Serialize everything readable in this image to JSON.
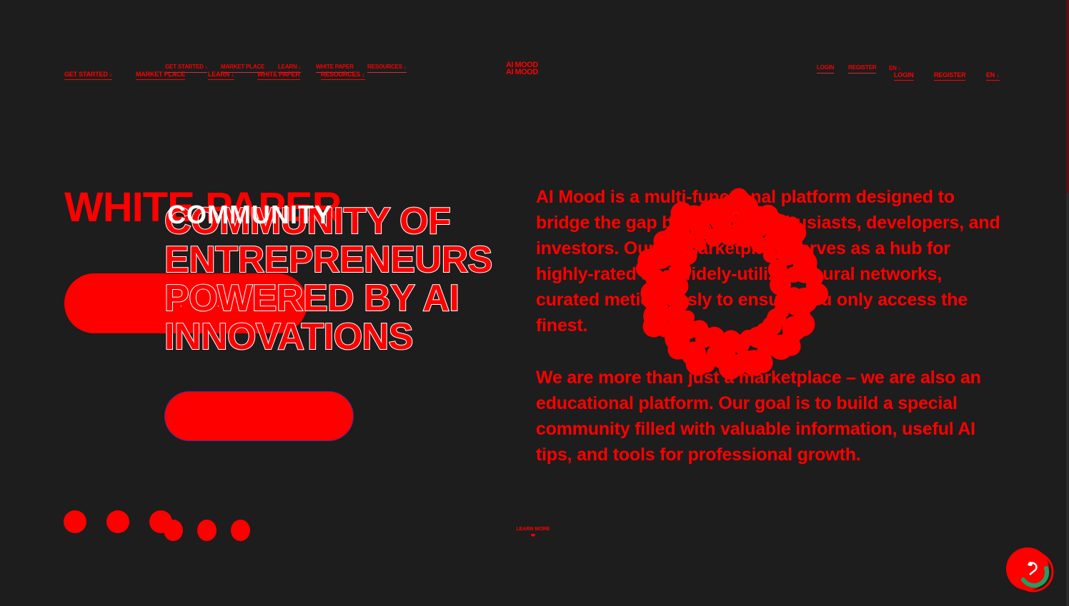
{
  "nav": {
    "left": [
      {
        "label": "GET STARTED ↓"
      },
      {
        "label": "MARKET PLACE"
      },
      {
        "label": "LEARN ↓"
      },
      {
        "label": "WHITE PAPER"
      },
      {
        "label": "RESOURCES ↓"
      }
    ],
    "left_ghost": [
      {
        "label": "GET STARTED ↓"
      },
      {
        "label": "MARKET PLACE"
      },
      {
        "label": "LEARN ↓"
      },
      {
        "label": "WHITE PAPER"
      },
      {
        "label": "RESOURCES ↓"
      }
    ],
    "right": [
      {
        "label": "LOGIN"
      },
      {
        "label": "REGISTER"
      },
      {
        "label": "EN ↓"
      }
    ],
    "right_ghost": [
      {
        "label": "LOGIN"
      },
      {
        "label": "REGISTER"
      },
      {
        "label": "EN ↓"
      }
    ]
  },
  "logo": {
    "line1": "AI MOOD",
    "line2": "AI MOOD"
  },
  "hero": {
    "white_paper_title": "WHITE PAPER",
    "community_title": "COMMUNITY OF ENTREPRENEURS POWERED BY AI INNOVATIONS",
    "community_ghost": "COMMUNITY",
    "button_dots": "· · · · ·"
  },
  "content": {
    "paragraph1": "AI Mood is a multi-functional platform designed to bridge the gap between AI enthusiasts, developers, and investors. Our AI-marketplace serves as a hub for highly-rated and widely-utilized neural networks, curated meticulously to ensure you only access the finest.",
    "paragraph2": "We are more than just a marketplace – we are also an educational platform. Our goal is to build a special community filled with valuable information, useful AI tips, and tools for professional growth."
  },
  "learn_more": {
    "label": "LEARN MORE",
    "arrow": "❤"
  },
  "colors": {
    "accent": "#ff0000",
    "background": "#1d1d1d",
    "chat_green": "#20a060"
  },
  "icons": {
    "chat": "chat-bubble-icon",
    "loader": "spinner-ring-icon"
  }
}
